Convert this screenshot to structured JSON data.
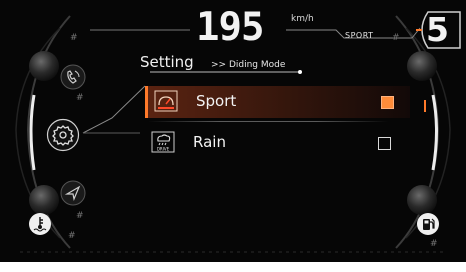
{
  "header": {
    "speed": "195",
    "speed_unit": "km/h",
    "ride_mode": "SPORT",
    "gear": "5"
  },
  "menu": {
    "title": "Setting",
    "breadcrumb": ">> Diding Mode",
    "items": [
      {
        "label": "Sport",
        "selected": true,
        "icon": "sport-mode-icon"
      },
      {
        "label": "Rain",
        "selected": false,
        "icon": "rain-drive-icon",
        "icon_text": "DRIVE"
      }
    ]
  },
  "side_icons": {
    "left": [
      "phone-icon",
      "settings-gear-icon",
      "navigation-arrow-icon",
      "coolant-temperature-icon"
    ],
    "right": [
      "fuel-pump-icon"
    ]
  },
  "colors": {
    "background": "#060606",
    "accent": "#ff7a2a",
    "selected_row": "#5a2311",
    "text": "#f0f0f0"
  }
}
